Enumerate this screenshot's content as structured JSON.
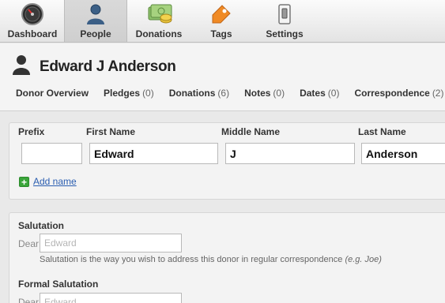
{
  "toolbar": {
    "items": [
      {
        "label": "Dashboard",
        "icon": "dashboard-gauge-icon"
      },
      {
        "label": "People",
        "icon": "people-icon",
        "active": true
      },
      {
        "label": "Donations",
        "icon": "money-icon"
      },
      {
        "label": "Tags",
        "icon": "tag-icon"
      },
      {
        "label": "Settings",
        "icon": "switch-icon"
      }
    ]
  },
  "person": {
    "name": "Edward J Anderson"
  },
  "subtabs": [
    {
      "label": "Donor Overview",
      "count": ""
    },
    {
      "label": "Pledges",
      "count": "(0)"
    },
    {
      "label": "Donations",
      "count": "(6)"
    },
    {
      "label": "Notes",
      "count": "(0)"
    },
    {
      "label": "Dates",
      "count": "(0)"
    },
    {
      "label": "Correspondence",
      "count": "(2)"
    }
  ],
  "name_fields": {
    "prefix_label": "Prefix",
    "first_label": "First Name",
    "middle_label": "Middle Name",
    "last_label": "Last Name",
    "prefix_value": "",
    "first_value": "Edward",
    "middle_value": "J",
    "last_value": "Anderson",
    "add_name_label": "Add name"
  },
  "salutation": {
    "label": "Salutation",
    "prefix_word": "Dear",
    "placeholder": "Edward",
    "help_text": "Salutation is the way you wish to address this donor in regular correspondence",
    "help_example": "(e.g. Joe)",
    "formal_label": "Formal Salutation",
    "formal_prefix_word": "Dear",
    "formal_placeholder": "Edward"
  },
  "colors": {
    "link": "#2a5db0",
    "add_icon": "#3aa53a",
    "tag_icon": "#f08a24"
  }
}
